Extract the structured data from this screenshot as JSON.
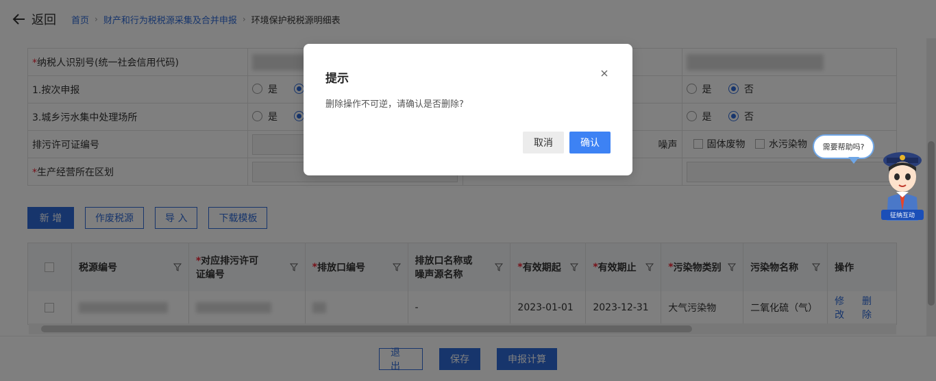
{
  "header": {
    "back_label": "返回",
    "breadcrumb": [
      "首页",
      "财产和行为税税源采集及合并申报",
      "环境保护税税源明细表"
    ]
  },
  "form": {
    "rows": [
      {
        "label": "纳税人识别号(统一社会信用代码)",
        "required": true
      },
      {
        "label": "1.按次申报",
        "required": false
      },
      {
        "label": "3.城乡污水集中处理场所",
        "required": false
      },
      {
        "label": "排污许可证编号",
        "required": false
      },
      {
        "label": "生产经营所在区划",
        "required": true
      }
    ],
    "radio_yes": "是",
    "radio_no": "否",
    "pollutant_checks": [
      "噪声",
      "固体废物",
      "水污染物"
    ]
  },
  "actions": {
    "add": "新 增",
    "void": "作废税源",
    "import": "导 入",
    "download": "下载模板"
  },
  "table": {
    "headers": [
      "税源编号",
      "对应排污许可证编号",
      "排放口编号",
      "排放口名称或噪声源名称",
      "有效期起",
      "有效期止",
      "污染物类别",
      "污染物名称",
      "操作"
    ],
    "header_line1": [
      "税源编号",
      "对应排污许可",
      "排放口编号",
      "排放口名称或",
      "有效期起",
      "有效期止",
      "污染物类别",
      "污染物名称",
      "操作"
    ],
    "header_line2": [
      "",
      "证编号",
      "",
      "噪声源名称",
      "",
      "",
      "",
      "",
      ""
    ],
    "rows": [
      {
        "outlet_name": "-",
        "start": "2023-01-01",
        "end": "2023-12-31",
        "category": "大气污染物",
        "name": "二氧化硫（气）",
        "edit": "修改",
        "delete": "删除"
      }
    ]
  },
  "footer": {
    "exit": "退 出",
    "save": "保存",
    "calc": "申报计算"
  },
  "helper": {
    "bubble": "需要帮助吗?",
    "badge": "征纳互动"
  },
  "dialog": {
    "title": "提示",
    "message": "删除操作不可逆，请确认是否删除?",
    "cancel": "取消",
    "confirm": "确认"
  },
  "colors": {
    "accent": "#2f6bd8",
    "confirm": "#3d82f4",
    "required": "#ee2233"
  }
}
